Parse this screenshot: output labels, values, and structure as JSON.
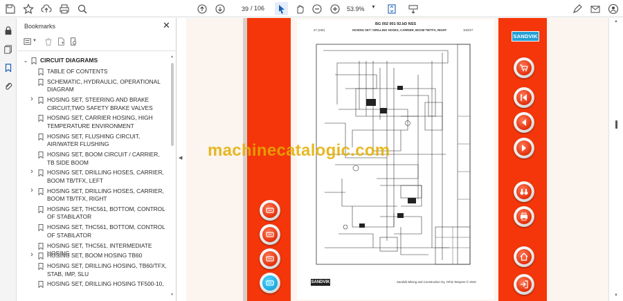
{
  "toolbar": {
    "page_current": "39",
    "page_total": "/ 106",
    "zoom": "53.9%"
  },
  "bookmarks": {
    "title": "Bookmarks",
    "root": "CIRCUIT DIAGRAMS",
    "items": [
      {
        "label": "TABLE OF CONTENTS",
        "expandable": false
      },
      {
        "label": "SCHEMATIC, HYDRAULIC, OPERATIONAL DIAGRAM",
        "expandable": false
      },
      {
        "label": "HOSING SET, STEERING AND BRAKE CIRCUIT,TWO SAFETY BRAKE VALVES",
        "expandable": true
      },
      {
        "label": "HOSING SET, CARRIER HOSING, HIGH TEMPERATURE ENVIRONMENT",
        "expandable": false
      },
      {
        "label": "HOSING SET, FLUSHING CIRCUIT, AIR/WATER FLUSHING",
        "expandable": false
      },
      {
        "label": "HOSING SET, BOOM CIRCUIT / CARRIER, TB SIDE BOOM",
        "expandable": false
      },
      {
        "label": "HOSING SET, DRILLING HOSES, CARRIER, BOOM TB/TFX, LEFT",
        "expandable": true
      },
      {
        "label": "HOSING SET, DRILLING HOSES, CARRIER, BOOM TB/TFX, RIGHT",
        "expandable": true
      },
      {
        "label": "HOSING SET, THC561, BOTTOM, CONTROL OF STABILATOR",
        "expandable": false
      },
      {
        "label": "HOSING SET, THC561, BOTTOM, CONTROL OF STABILATOR",
        "expandable": false
      },
      {
        "label": "HOSING SET, THC561, INTERMEDIATE HOSING",
        "expandable": false
      },
      {
        "label": "HOSING SET, BOOM HOSING TB60",
        "expandable": true
      },
      {
        "label": "HOSING SET, DRILLING HOSING, TB60/TFX, STAB, IMP, SLU",
        "expandable": false
      },
      {
        "label": "HOSING SET, DRILLING HOSING TF500-10,",
        "expandable": false
      }
    ]
  },
  "document": {
    "sheet_title": "BG 002 001 92.bD NSS",
    "sheet_page": "27 (106)",
    "sheet_heading": "HOSING SET / DRILLING HOSES, CARRIER, BOOM TB/TFX, RIGHT",
    "sheet_code": "10/2/27",
    "footer_logo": "SANDVIK",
    "footer_text": "Sandvik Mining and Construction Oy, Orhis Tampere © 2010",
    "brand_badge": "SANDVIK",
    "watermark": "machinecatalogic.com"
  },
  "nav_buttons_left": [
    "wrench-icon",
    "wrench-icon",
    "wrench-icon",
    "wrench-icon"
  ],
  "nav_buttons_right": [
    "cart-icon",
    "first-page-icon",
    "prev-page-icon",
    "next-page-icon",
    "binoculars-icon",
    "printer-icon",
    "home-icon",
    "exit-icon"
  ],
  "colors": {
    "stripe": "#f4360a",
    "badge": "#25a0d5",
    "watermark": "#e3ad00"
  }
}
